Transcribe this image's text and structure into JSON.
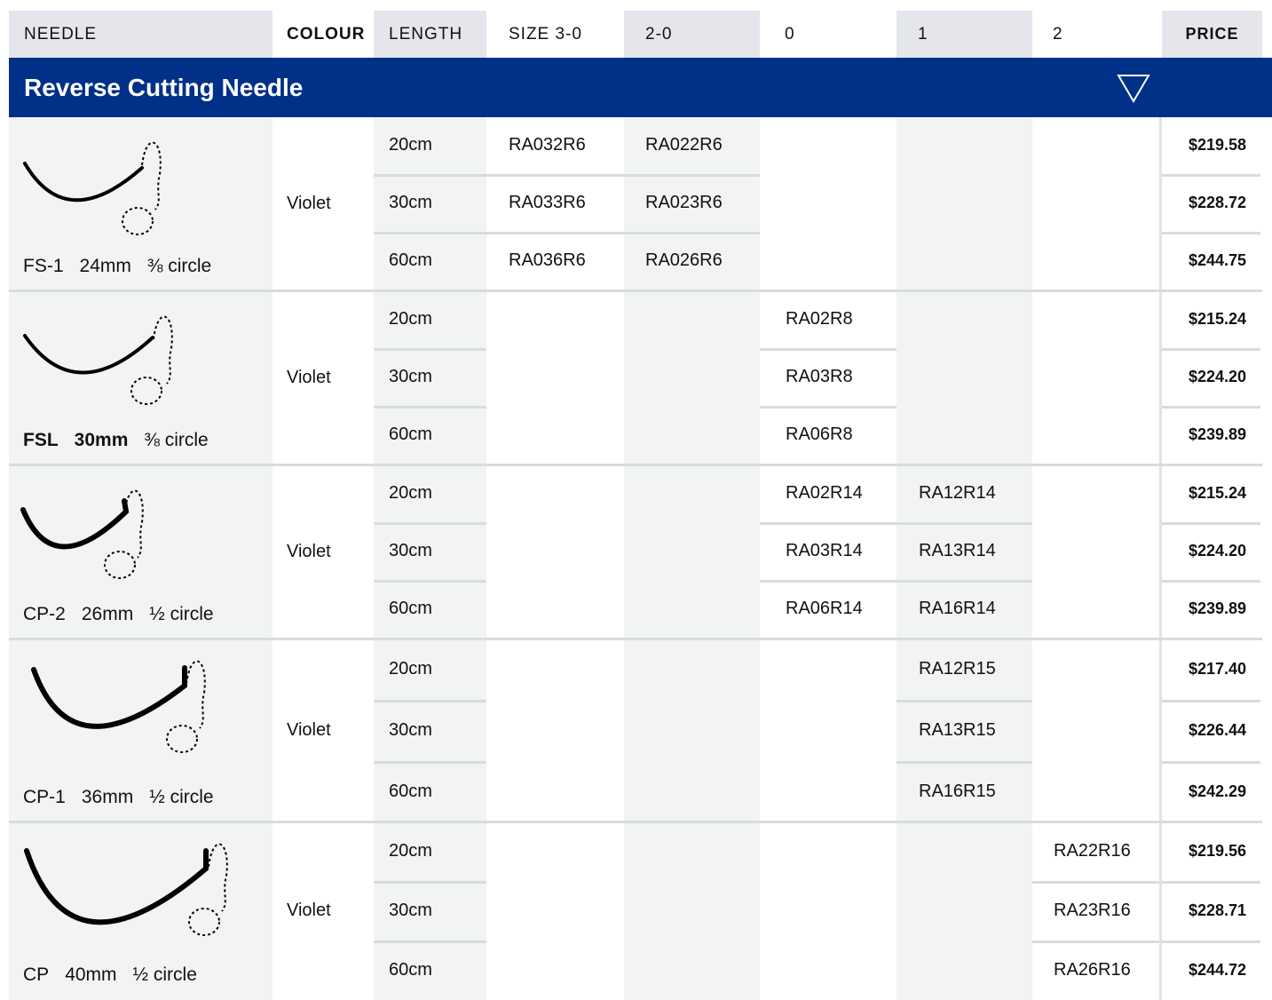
{
  "header": {
    "needle": "NEEDLE",
    "colour": "COLOUR",
    "length": "LENGTH",
    "size_3_0": "SIZE 3-0",
    "size_2_0": "2-0",
    "size_0": "0",
    "size_1": "1",
    "size_2": "2",
    "price": "PRICE"
  },
  "section": {
    "title": "Reverse Cutting Needle",
    "toggle_icon": "triangle-down-icon"
  },
  "colors": {
    "banner": "#003087",
    "column_shade": "#f2f3f3",
    "header_shade": "#e4e6ec"
  },
  "groups": [
    {
      "needle_code": "FS-1",
      "needle_size": "24mm",
      "needle_shape": "⅜ circle",
      "bold": false,
      "colour": "Violet",
      "rows": [
        {
          "length": "20cm",
          "s30": "RA032R6",
          "s20": "RA022R6",
          "s0": "",
          "s1": "",
          "s2": "",
          "price": "$219.58"
        },
        {
          "length": "30cm",
          "s30": "RA033R6",
          "s20": "RA023R6",
          "s0": "",
          "s1": "",
          "s2": "",
          "price": "$228.72"
        },
        {
          "length": "60cm",
          "s30": "RA036R6",
          "s20": "RA026R6",
          "s0": "",
          "s1": "",
          "s2": "",
          "price": "$244.75"
        }
      ]
    },
    {
      "needle_code": "FSL",
      "needle_size": "30mm",
      "needle_shape": "⅜ circle",
      "bold": true,
      "colour": "Violet",
      "rows": [
        {
          "length": "20cm",
          "s30": "",
          "s20": "",
          "s0": "RA02R8",
          "s1": "",
          "s2": "",
          "price": "$215.24"
        },
        {
          "length": "30cm",
          "s30": "",
          "s20": "",
          "s0": "RA03R8",
          "s1": "",
          "s2": "",
          "price": "$224.20"
        },
        {
          "length": "60cm",
          "s30": "",
          "s20": "",
          "s0": "RA06R8",
          "s1": "",
          "s2": "",
          "price": "$239.89"
        }
      ]
    },
    {
      "needle_code": "CP-2",
      "needle_size": "26mm",
      "needle_shape": "½ circle",
      "bold": false,
      "colour": "Violet",
      "rows": [
        {
          "length": "20cm",
          "s30": "",
          "s20": "",
          "s0": "RA02R14",
          "s1": "RA12R14",
          "s2": "",
          "price": "$215.24"
        },
        {
          "length": "30cm",
          "s30": "",
          "s20": "",
          "s0": "RA03R14",
          "s1": "RA13R14",
          "s2": "",
          "price": "$224.20"
        },
        {
          "length": "60cm",
          "s30": "",
          "s20": "",
          "s0": "RA06R14",
          "s1": "RA16R14",
          "s2": "",
          "price": "$239.89"
        }
      ]
    },
    {
      "needle_code": "CP-1",
      "needle_size": "36mm",
      "needle_shape": "½ circle",
      "bold": false,
      "colour": "Violet",
      "rows": [
        {
          "length": "20cm",
          "s30": "",
          "s20": "",
          "s0": "",
          "s1": "RA12R15",
          "s2": "",
          "price": "$217.40"
        },
        {
          "length": "30cm",
          "s30": "",
          "s20": "",
          "s0": "",
          "s1": "RA13R15",
          "s2": "",
          "price": "$226.44"
        },
        {
          "length": "60cm",
          "s30": "",
          "s20": "",
          "s0": "",
          "s1": "RA16R15",
          "s2": "",
          "price": "$242.29"
        }
      ]
    },
    {
      "needle_code": "CP",
      "needle_size": "40mm",
      "needle_shape": "½ circle",
      "bold": false,
      "colour": "Violet",
      "rows": [
        {
          "length": "20cm",
          "s30": "",
          "s20": "",
          "s0": "",
          "s1": "",
          "s2": "RA22R16",
          "price": "$219.56"
        },
        {
          "length": "30cm",
          "s30": "",
          "s20": "",
          "s0": "",
          "s1": "",
          "s2": "RA23R16",
          "price": "$228.71"
        },
        {
          "length": "60cm",
          "s30": "",
          "s20": "",
          "s0": "",
          "s1": "",
          "s2": "RA26R16",
          "price": "$244.72"
        }
      ]
    }
  ]
}
